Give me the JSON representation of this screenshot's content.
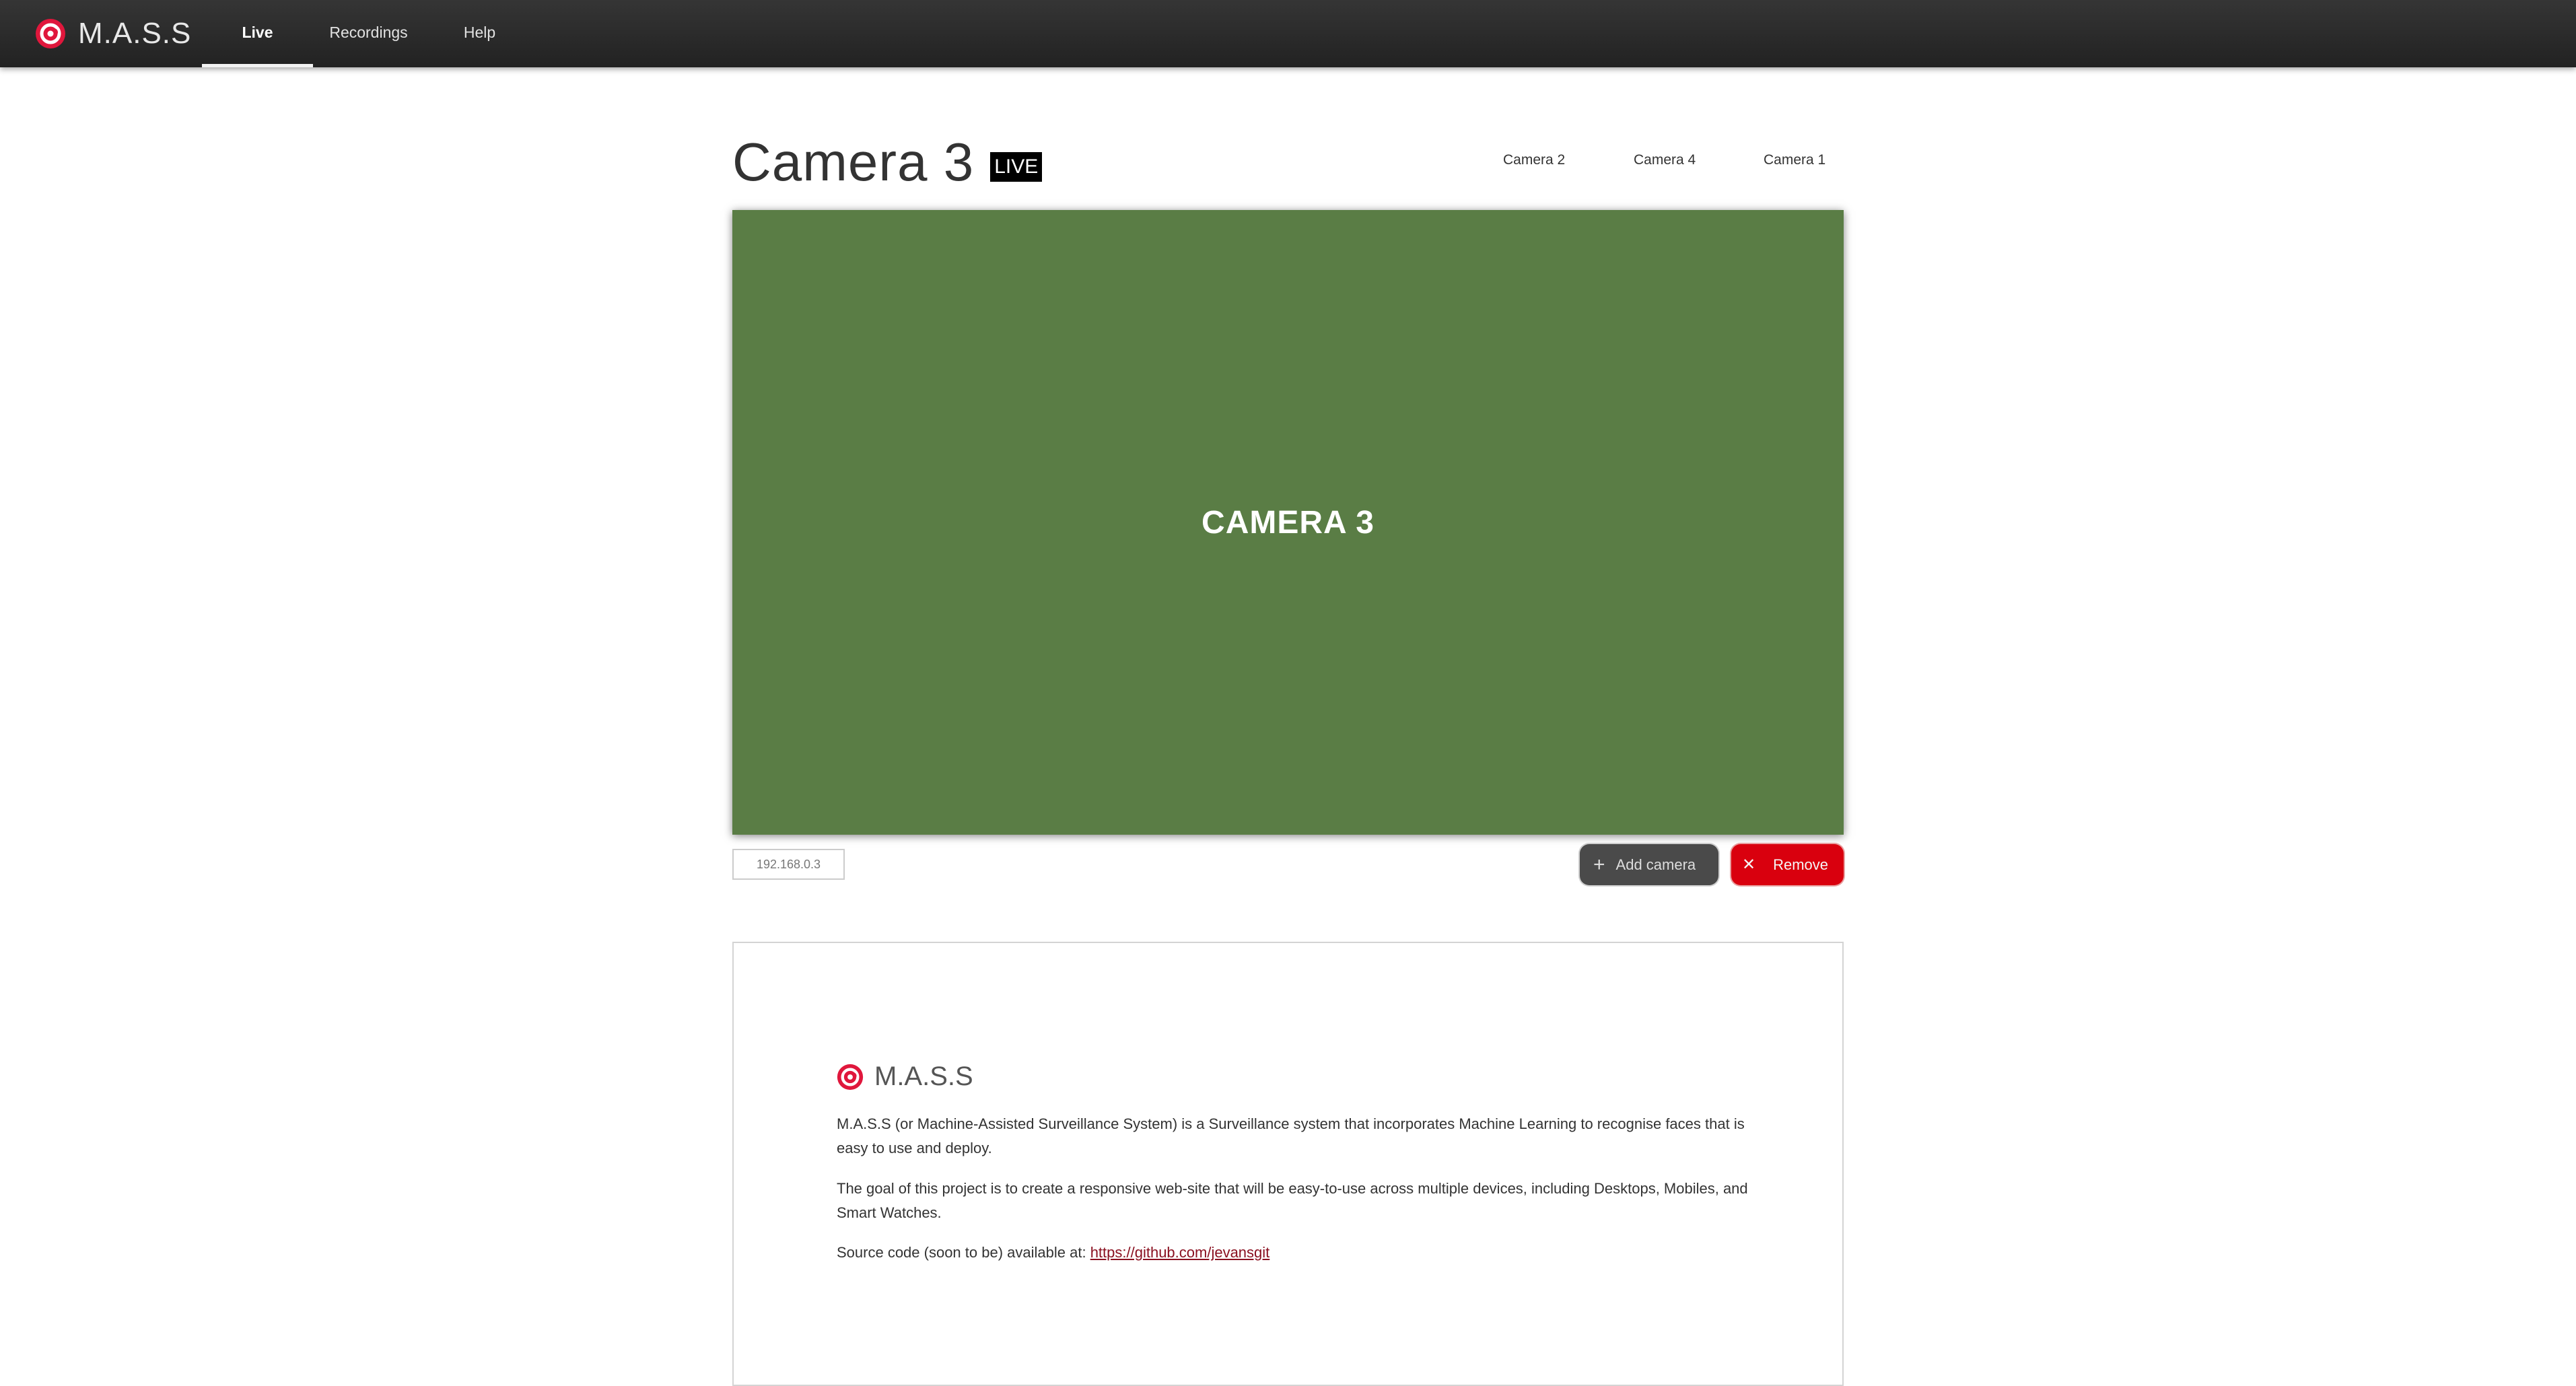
{
  "nav": {
    "brand": "M.A.S.S",
    "tabs": [
      {
        "label": "Live",
        "active": true
      },
      {
        "label": "Recordings",
        "active": false
      },
      {
        "label": "Help",
        "active": false
      }
    ]
  },
  "camera": {
    "title": "Camera 3",
    "live_badge": "LIVE",
    "other_cameras": [
      "Camera 2",
      "Camera 4",
      "Camera 1"
    ],
    "video_label": "CAMERA 3",
    "ip_address": "192.168.0.3"
  },
  "actions": {
    "add_label": "Add camera",
    "remove_label": "Remove"
  },
  "about": {
    "brand": "M.A.S.S",
    "para1": "M.A.S.S (or Machine-Assisted Surveillance System) is a Surveillance system that incorporates Machine Learning to recognise faces that is easy to use and deploy.",
    "para2": "The goal of this project is to create a responsive web-site that will be easy-to-use across multiple devices, including Desktops, Mobiles, and Smart Watches.",
    "source_prefix": "Source code (soon to be) available at: ",
    "source_link": "https://github.com/jevansgit"
  },
  "colors": {
    "brand_red": "#e0173c",
    "video_green": "#5a7d45",
    "remove_red": "#d9000e",
    "navbar_dark": "#2a2a2a"
  },
  "icons": {
    "logo": "camera-lens-icon",
    "add": "plus-icon",
    "remove": "close-icon"
  }
}
